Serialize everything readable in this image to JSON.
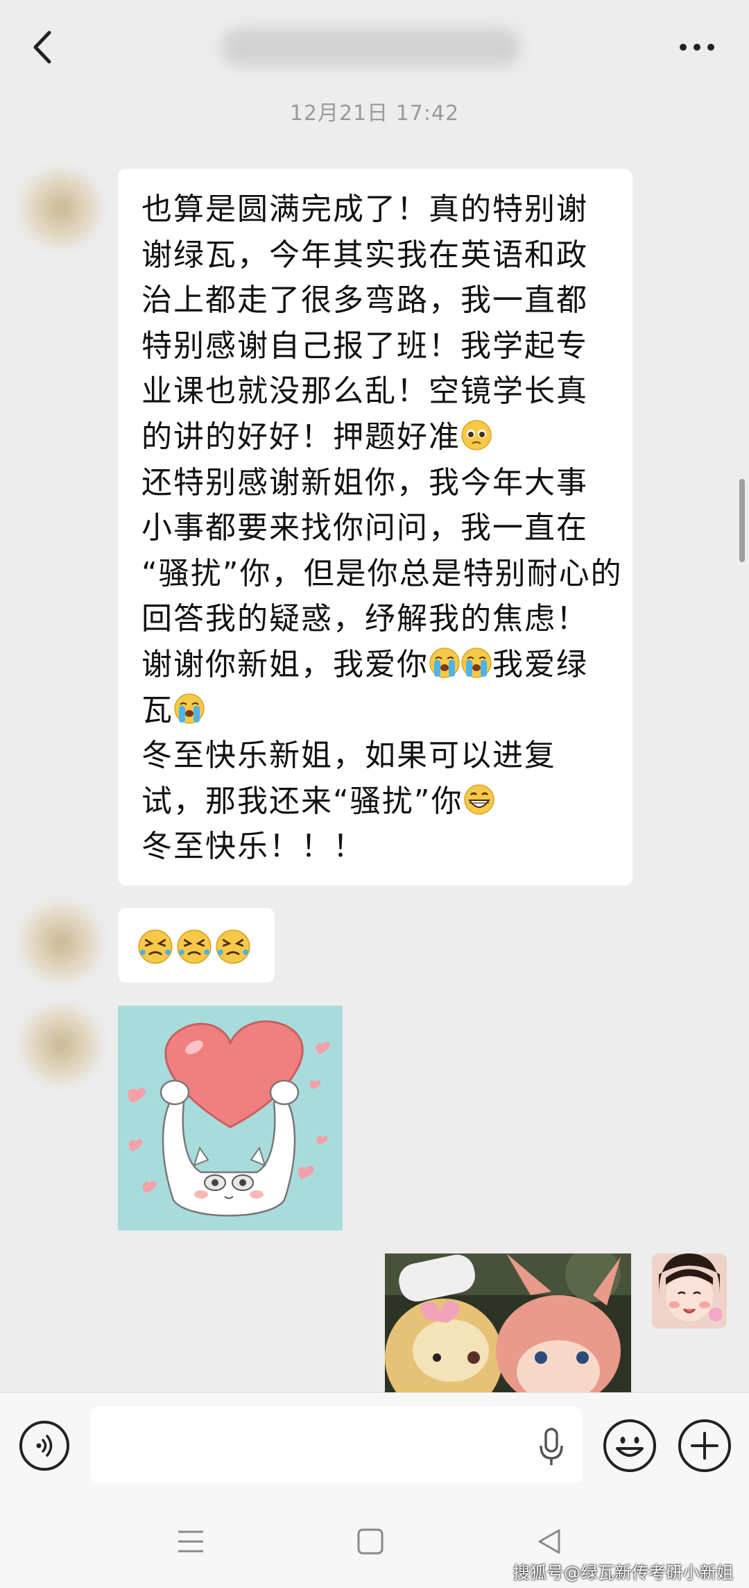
{
  "header": {
    "back_icon": "chevron-left-icon",
    "title": "",
    "more_icon": "more-horizontal-icon"
  },
  "chat": {
    "timestamp": "12月21日 17:42",
    "message1_lines": [
      "也算是圆满完成了！真的特别谢",
      "谢绿瓦，今年其实我在英语和政",
      "治上都走了很多弯路，我一直都",
      "特别感谢自己报了班！我学起专",
      "业课也就没那么乱！空镜学长真",
      "的讲的好好！押题好准",
      "还特别感谢新姐你，我今年大事",
      "小事都要来找你问问，我一直在",
      "“骚扰”你，但是你总是特别耐心的",
      "回答我的疑惑，纾解我的焦虑！",
      "谢谢你新姐，我爱你",
      "我爱绿",
      "瓦",
      "冬至快乐新姐，如果可以进复",
      "试，那我还来“骚扰”你",
      "冬至快乐！！！"
    ],
    "message2_emoji": "crying-angry-emoji ×3",
    "sticker": "heart-cat-sticker",
    "sent_photo": "plush-toys-photo"
  },
  "input": {
    "placeholder": "",
    "voice_icon": "voice-icon",
    "mic_icon": "mic-icon",
    "emoji_icon": "smiley-icon",
    "plus_icon": "plus-icon"
  },
  "navbar": {
    "menu_icon": "menu-icon",
    "home_icon": "home-square-icon",
    "back_icon": "back-triangle-icon"
  },
  "watermark": "搜狐号@绿瓦新传考研小新姐",
  "colors": {
    "background": "#ededed",
    "bubble": "#ffffff",
    "sticker_bg": "#a8dcdc",
    "heart": "#f08080"
  }
}
